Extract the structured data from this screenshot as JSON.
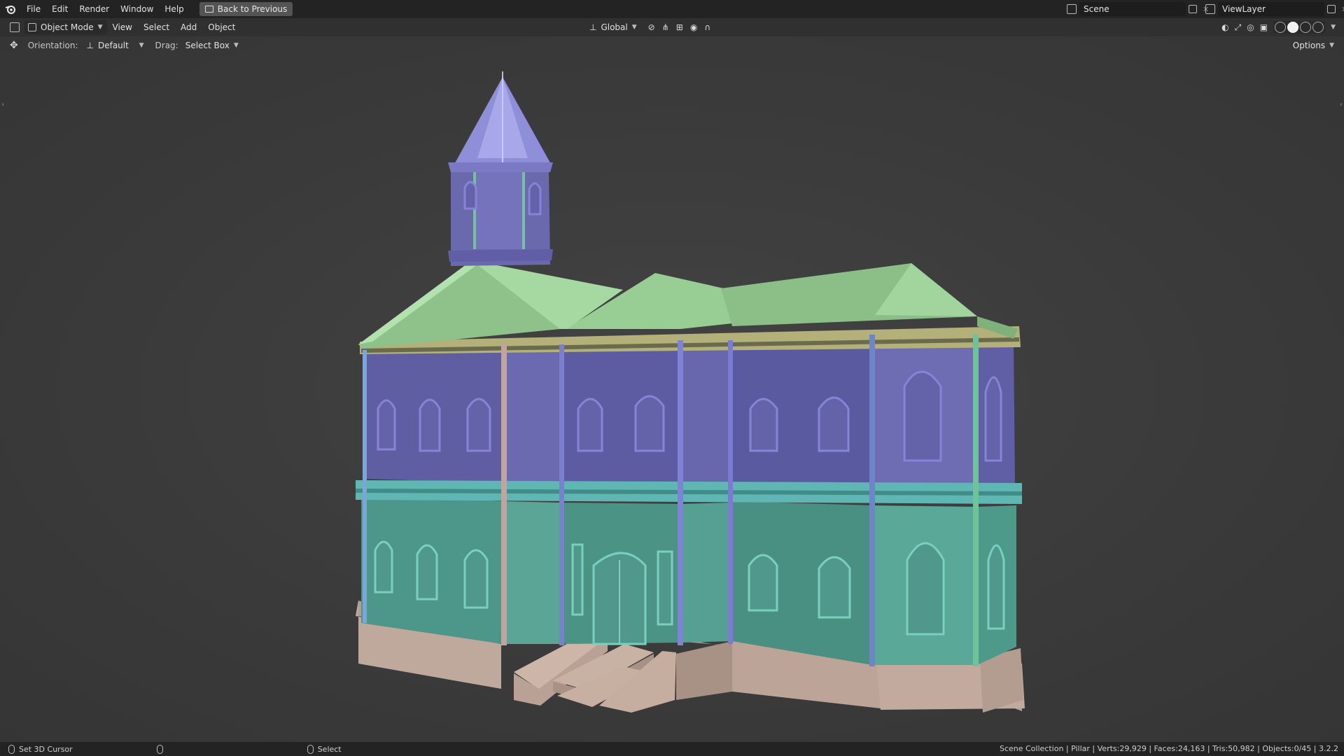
{
  "menubar": {
    "items": [
      "File",
      "Edit",
      "Render",
      "Window",
      "Help"
    ],
    "back_button": "Back to Previous",
    "scene": "Scene",
    "view_layer": "ViewLayer"
  },
  "header": {
    "mode": "Object Mode",
    "menus": [
      "View",
      "Select",
      "Add",
      "Object"
    ],
    "transform_orientation": "Global"
  },
  "tool_settings": {
    "orientation_label": "Orientation:",
    "orientation_value": "Default",
    "drag_label": "Drag:",
    "drag_value": "Select Box",
    "options": "Options"
  },
  "statusbar": {
    "left_action": "Set 3D Cursor",
    "middle_action": "Select",
    "stats": "Scene Collection | Pillar | Verts:29,929 | Faces:24,163 | Tris:50,982 | Objects:0/45 | 3.2.2"
  },
  "colors": {
    "roof": "#8fc48f",
    "upper_wall": "#6d6bb0",
    "lower_wall": "#4f9a8d",
    "base": "#b9a396",
    "trim": "#67c0c0"
  },
  "icons": [
    "blender-logo-icon",
    "back-icon",
    "scene-icon",
    "viewlayer-icon",
    "move-tool-icon",
    "mouse-icon"
  ]
}
